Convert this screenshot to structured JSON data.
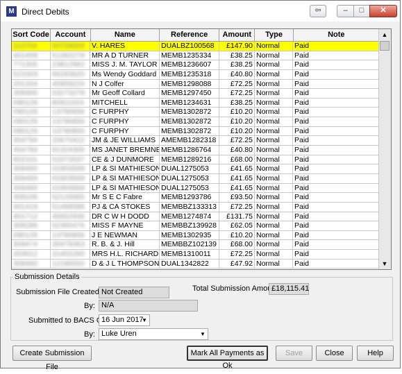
{
  "window": {
    "title": "Direct Debits",
    "app_icon": "M"
  },
  "grid": {
    "columns": {
      "sort_code": "Sort Code",
      "account": "Account",
      "name": "Name",
      "reference": "Reference",
      "amount": "Amount",
      "type": "Type",
      "note": "Note"
    },
    "rows": [
      {
        "sort": "110704",
        "acc": "00758604",
        "name": "V. HARES",
        "ref": "DUALBZ100568",
        "amt": "£147.90",
        "type": "Normal",
        "note": "Paid"
      },
      {
        "sort": "401409",
        "acc": "51362279",
        "name": "MR A D TURNER",
        "ref": "MEMB1235334",
        "amt": "£38.25",
        "type": "Normal",
        "note": "Paid"
      },
      {
        "sort": "771305",
        "acc": "23812962",
        "name": "MISS J. M. TAYLOR",
        "ref": "MEMB1236607",
        "amt": "£38.25",
        "type": "Normal",
        "note": "Paid"
      },
      {
        "sort": "521003",
        "acc": "66283620",
        "name": "Ms Wendy Goddard",
        "ref": "MEMB1235318",
        "amt": "£40.80",
        "type": "Normal",
        "note": "Paid"
      },
      {
        "sort": "201334",
        "acc": "40959224",
        "name": "N J Colfer",
        "ref": "MEMB1298088",
        "amt": "£72.25",
        "type": "Normal",
        "note": "Paid"
      },
      {
        "sort": "309300",
        "acc": "03273279",
        "name": "Mr Geoff Collard",
        "ref": "MEMB1297450",
        "amt": "£72.25",
        "type": "Normal",
        "note": "Paid"
      },
      {
        "sort": "090126",
        "acc": "80911024",
        "name": "MITCHELL",
        "ref": "MEMB1234631",
        "amt": "£38.25",
        "type": "Normal",
        "note": "Paid"
      },
      {
        "sort": "090126",
        "acc": "13790856",
        "name": "C FURPHY",
        "ref": "MEMB1302872",
        "amt": "£10.20",
        "type": "Normal",
        "note": "Paid"
      },
      {
        "sort": "090126",
        "acc": "13790856",
        "name": "C FURPHY",
        "ref": "MEMB1302872",
        "amt": "£10.20",
        "type": "Normal",
        "note": "Paid"
      },
      {
        "sort": "090126",
        "acc": "13790856",
        "name": "C FURPHY",
        "ref": "MEMB1302872",
        "amt": "£10.20",
        "type": "Normal",
        "note": "Paid"
      },
      {
        "sort": "404794",
        "acc": "20670412",
        "name": "JM & JE WILLIAMS",
        "ref": "AMEMB1282318",
        "amt": "£72.25",
        "type": "Normal",
        "note": "Paid"
      },
      {
        "sort": "404793",
        "acc": "91324305",
        "name": "MS JANET BREMNER",
        "ref": "MEMB1286764",
        "amt": "£40.80",
        "type": "Normal",
        "note": "Paid"
      },
      {
        "sort": "602101",
        "acc": "51072637",
        "name": "CE & J DUNMORE",
        "ref": "MEMB1289216",
        "amt": "£68.00",
        "type": "Normal",
        "note": "Paid"
      },
      {
        "sort": "309460",
        "acc": "01903569",
        "name": "LP & SI MATHIESON",
        "ref": "DUAL1275053",
        "amt": "£41.65",
        "type": "Normal",
        "note": "Paid"
      },
      {
        "sort": "309460",
        "acc": "01903569",
        "name": "LP & SI MATHIESON",
        "ref": "DUAL1275053",
        "amt": "£41.65",
        "type": "Normal",
        "note": "Paid"
      },
      {
        "sort": "309460",
        "acc": "01903569",
        "name": "LP & SI MATHIESON",
        "ref": "DUAL1275053",
        "amt": "£41.65",
        "type": "Normal",
        "note": "Paid"
      },
      {
        "sort": "309106",
        "acc": "52120065",
        "name": "Mr S E C Fabre",
        "ref": "MEMB1293786",
        "amt": "£93.50",
        "type": "Normal",
        "note": "Paid"
      },
      {
        "sort": "401419",
        "acc": "51468588",
        "name": "PJ & CA STOKES",
        "ref": "MEMBBZ133313",
        "amt": "£72.25",
        "type": "Normal",
        "note": "Paid"
      },
      {
        "sort": "401712",
        "acc": "46652936",
        "name": "DR C W H DODD",
        "ref": "MEMB1274874",
        "amt": "£131.75",
        "type": "Normal",
        "note": "Paid"
      },
      {
        "sort": "309286",
        "acc": "02360476",
        "name": "MISS F MAYNE",
        "ref": "MEMBBZ139928",
        "amt": "£62.05",
        "type": "Normal",
        "note": "Paid"
      },
      {
        "sort": "090126",
        "acc": "13790856",
        "name": "J E NEWMAN",
        "ref": "MEMB1302935",
        "amt": "£10.20",
        "type": "Normal",
        "note": "Paid"
      },
      {
        "sort": "309474",
        "acc": "30479363",
        "name": "R. B. & J. Hill",
        "ref": "MEMBBZ102139",
        "amt": "£68.00",
        "type": "Normal",
        "note": "Paid"
      },
      {
        "sort": "403612",
        "acc": "31402260",
        "name": "MRS H.L. RICHARDS",
        "ref": "MEMB1310011",
        "amt": "£72.25",
        "type": "Normal",
        "note": "Paid"
      },
      {
        "sort": "309460",
        "acc": "12190002",
        "name": "D & J L THOMPSON",
        "ref": "DUAL1342822",
        "amt": "£47.92",
        "type": "Normal",
        "note": "Paid"
      }
    ]
  },
  "submission": {
    "group_title": "Submission Details",
    "file_created_label": "Submission File Created On:",
    "file_created_value": "Not Created",
    "by_label": "By:",
    "by_value": "N/A",
    "total_label": "Total Submission Amount:",
    "total_value": "£18,115.41",
    "submitted_label": "Submitted to BACS On:",
    "submitted_value": "16 Jun  2017",
    "by2_label": "By:",
    "by2_value": "Luke Uren"
  },
  "buttons": {
    "create": "Create Submission File",
    "mark_all": "Mark All Payments as Ok",
    "save": "Save",
    "close": "Close",
    "help": "Help"
  },
  "colors": {
    "selected_row": "#ffff00"
  }
}
